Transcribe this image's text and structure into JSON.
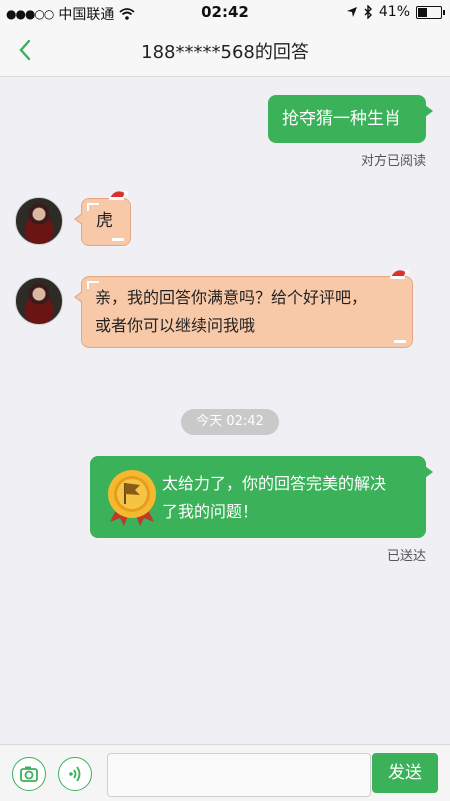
{
  "status_bar": {
    "carrier": "中国联通",
    "time": "02:42",
    "battery": "41%",
    "battery_level": 0.41
  },
  "nav": {
    "back_icon": "chevron-left-icon",
    "title": "188*****568的回答"
  },
  "messages": {
    "m1": {
      "text": "抢夺猜一种生肖",
      "status": "对方已阅读"
    },
    "m2": {
      "text": "虎"
    },
    "m3": {
      "line1": "亲，我的回答你满意吗？给个好评吧，",
      "line2": "或者你可以继续问我哦"
    },
    "time_divider": "今天 02:42",
    "m4": {
      "line1": "太给力了，你的回答完美的解决",
      "line2": "了我的问题！",
      "status": "已送达"
    }
  },
  "input_bar": {
    "camera_icon": "camera-icon",
    "voice_icon": "voice-icon",
    "input_value": "",
    "send_label": "发送"
  },
  "colors": {
    "accent": "#3bb15a",
    "answer_bubble": "#f8c9a8"
  }
}
